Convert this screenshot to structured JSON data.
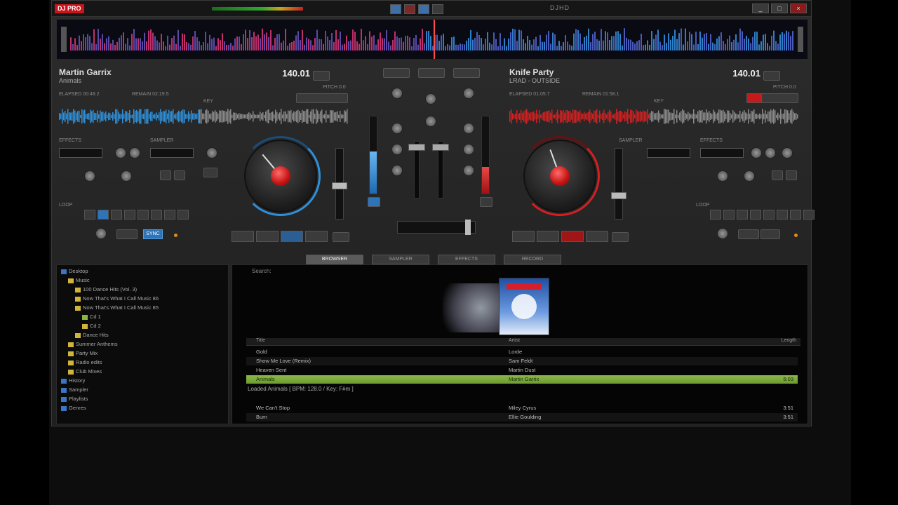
{
  "app": {
    "logo": "DJ PRO",
    "brand": "DJHD",
    "window_controls": [
      "_",
      "□",
      "×"
    ]
  },
  "deck_left": {
    "artist": "Martin Garrix",
    "title": "Animals",
    "bpm": "140.01",
    "info": [
      "ELAPSED 00:48.2",
      "REMAIN 02:19.5",
      "KEY",
      "PITCH 0.0"
    ],
    "accent": "#2f8fd8"
  },
  "deck_right": {
    "artist": "Knife Party",
    "title": "LRAD - OUTSIDE",
    "bpm": "140.01",
    "info": [
      "ELAPSED 01:05.7",
      "REMAIN 01:58.1",
      "KEY",
      "PITCH 0.0"
    ],
    "accent": "#d42020"
  },
  "browser": {
    "tabs": [
      "BROWSER",
      "SAMPLER",
      "EFFECTS",
      "RECORD"
    ],
    "search_label": "Search:",
    "columns": {
      "title": "Title",
      "artist": "Artist",
      "length": "Length"
    },
    "status_line": "Loaded Animals  [ BPM: 128.0 / Key: F#m ]"
  },
  "tree": [
    {
      "label": "Desktop",
      "icon": "monitor-icon",
      "indent": 0
    },
    {
      "label": "Music",
      "icon": "folder-icon",
      "indent": 1
    },
    {
      "label": "100 Dance Hits (Vol. 3)",
      "icon": "folder-icon",
      "indent": 2
    },
    {
      "label": "Now That's What I Call Music 86",
      "icon": "folder-icon",
      "indent": 2
    },
    {
      "label": "Now That's What I Call Music 85",
      "icon": "folder-icon",
      "indent": 2
    },
    {
      "label": "Cd 1",
      "icon": "folder-icon",
      "indent": 3
    },
    {
      "label": "Cd 2",
      "icon": "folder-icon",
      "indent": 3
    },
    {
      "label": "Dance Hits",
      "icon": "folder-icon",
      "indent": 2
    },
    {
      "label": "Summer Anthems",
      "icon": "folder-icon",
      "indent": 1
    },
    {
      "label": "Party Mix",
      "icon": "folder-icon",
      "indent": 1
    },
    {
      "label": "Radio edits",
      "icon": "folder-icon",
      "indent": 1
    },
    {
      "label": "Club Mixes",
      "icon": "folder-icon",
      "indent": 1
    },
    {
      "label": "History",
      "icon": "folder-icon",
      "indent": 0
    },
    {
      "label": "Sampler",
      "icon": "folder-icon",
      "indent": 0
    },
    {
      "label": "Playlists",
      "icon": "folder-icon",
      "indent": 0
    },
    {
      "label": "Genres",
      "icon": "folder-icon",
      "indent": 0
    }
  ],
  "files": [
    {
      "title": "Gold",
      "artist": "Lorde",
      "length": ""
    },
    {
      "title": "Show Me Love (Remix)",
      "artist": "Sam Feldt",
      "length": ""
    },
    {
      "title": "Heaven Sent",
      "artist": "Martin Dust",
      "length": ""
    },
    {
      "title": "Animals",
      "artist": "Martin Garrix",
      "length": "5:03"
    },
    {
      "title": "We Can't Stop",
      "artist": "Miley Cyrus",
      "length": "3:51"
    },
    {
      "title": "Burn",
      "artist": "Ellie Goulding",
      "length": "3:51"
    }
  ],
  "colors": {
    "deck_left_accent": "#2f8fd8",
    "deck_right_accent": "#d42020",
    "selection": "#8cb84a"
  }
}
